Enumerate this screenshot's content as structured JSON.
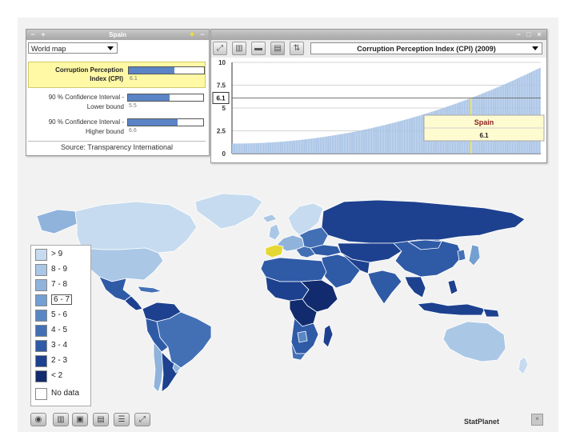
{
  "info_panel": {
    "title": "Spain",
    "view_select": "World map",
    "indicators": [
      {
        "label_line1": "Corruption Perception",
        "label_line2": "Index (CPI)",
        "value": "6.1",
        "fraction": 0.61,
        "selected": true
      },
      {
        "label_line1": "90 % Confidence Interval -",
        "label_line2": "Lower bound",
        "value": "5.5",
        "fraction": 0.55,
        "selected": false
      },
      {
        "label_line1": "90 % Confidence Interval -",
        "label_line2": "Higher bound",
        "value": "6.6",
        "fraction": 0.66,
        "selected": false
      }
    ],
    "source": "Source: Transparency International"
  },
  "chart_panel": {
    "indicator_select": "Corruption Perception Index (CPI)  (2009)",
    "tooltip_country": "Spain",
    "tooltip_value": "6.1",
    "marker_label": "6.1",
    "toolbar_icons": [
      "expand-icon",
      "bar-chart-icon",
      "map-icon",
      "table-icon",
      "sort-icon"
    ]
  },
  "chart_data": {
    "type": "bar",
    "title": "Corruption Perception Index (CPI)  (2009)",
    "ylim": [
      0,
      10
    ],
    "yticks": [
      "0",
      "2.5",
      "5",
      "7.5",
      "10"
    ],
    "series_min": 1.1,
    "series_max": 9.4,
    "n_countries": 180,
    "highlight": {
      "country": "Spain",
      "value": 6.1
    },
    "grid": true,
    "colors": {
      "bars": "#a9c4e6",
      "highlight": "#e9e34b"
    }
  },
  "legend": {
    "items": [
      {
        "label": "> 9",
        "color": "#c6dbef"
      },
      {
        "label": "8 - 9",
        "color": "#aac7e6"
      },
      {
        "label": "7 - 8",
        "color": "#8fb3db"
      },
      {
        "label": "6 - 7",
        "color": "#739fd1",
        "highlight": true
      },
      {
        "label": "5 - 6",
        "color": "#5a87c4"
      },
      {
        "label": "4 - 5",
        "color": "#4370b5"
      },
      {
        "label": "3 - 4",
        "color": "#2f5aa6"
      },
      {
        "label": "2 - 3",
        "color": "#1d418f"
      },
      {
        "label": "< 2",
        "color": "#112b6e"
      },
      {
        "label": "No data",
        "color": "#ffffff"
      }
    ]
  },
  "bottom_toolbar": {
    "icons": [
      "eye-icon",
      "bar-chart-icon",
      "map-icon",
      "table-icon",
      "layers-icon",
      "fullscreen-icon"
    ],
    "brand": "StatPlanet"
  },
  "colors": {
    "highlight_row": "#fff9a6",
    "spain": "#e6d832",
    "ocean": "#ffffff"
  }
}
